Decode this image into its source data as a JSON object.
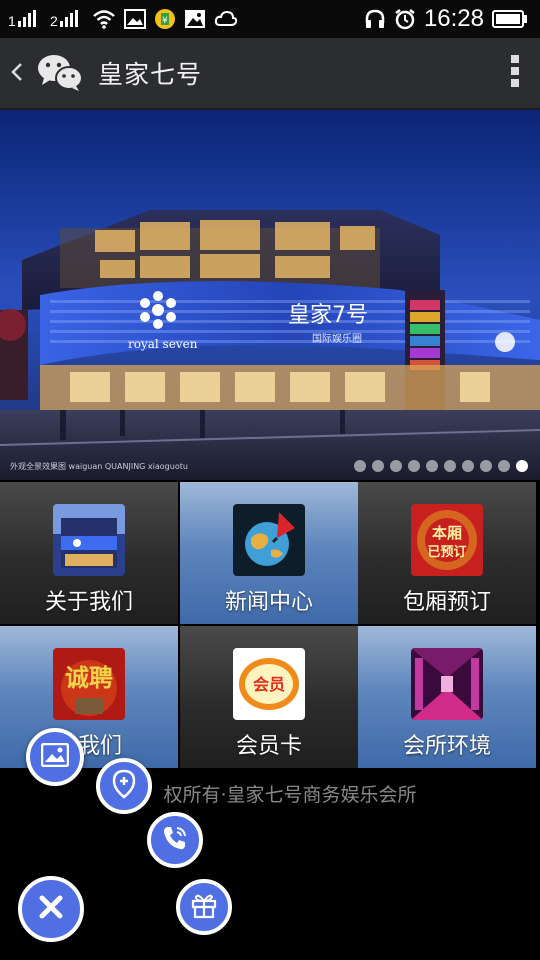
{
  "status_bar": {
    "time": "16:28",
    "icons": [
      "signal-icon",
      "signal-icon",
      "wifi-icon",
      "image-icon",
      "app-icon",
      "image-icon",
      "cloud-icon",
      "headphone-icon",
      "alarm-icon",
      "battery-icon"
    ]
  },
  "header": {
    "title": "皇家七号",
    "back_icon": "chevron-left-icon",
    "logo_icon": "wechat-icon",
    "more_icon": "more-vertical-icon"
  },
  "banner": {
    "caption": "外观全景效果图  waiguan QUANJING xiaoguotu",
    "building_sign_cn": "皇家7号",
    "building_sign_sub": "国际娱乐圈",
    "building_sign_en": "royal seven",
    "slide_count": 10,
    "active_slide": 10
  },
  "menu": {
    "items": [
      {
        "label": "关于我们",
        "icon": "building-icon"
      },
      {
        "label": "新闻中心",
        "icon": "globe-pen-icon"
      },
      {
        "label": "包厢预订",
        "icon": "booked-room-icon",
        "badge_text": "本厢已预订"
      },
      {
        "label": "入我们",
        "icon": "recruit-icon",
        "badge_text": "诚聘"
      },
      {
        "label": "会员卡",
        "icon": "member-card-icon",
        "badge_text": "会员"
      },
      {
        "label": "会所环境",
        "icon": "interior-icon"
      }
    ]
  },
  "footer": {
    "copyright": "权所有·皇家七号商务娱乐会所"
  },
  "fabs": {
    "close_icon": "close-icon",
    "gallery_icon": "image-icon",
    "location_icon": "location-pin-icon",
    "phone_icon": "phone-icon",
    "gift_icon": "gift-icon"
  },
  "colors": {
    "fab_blue": "#4f6fe3",
    "tile_dark": "#2c2c2c",
    "tile_blue": "#5f86bd",
    "header_bg": "#2b2d30"
  }
}
